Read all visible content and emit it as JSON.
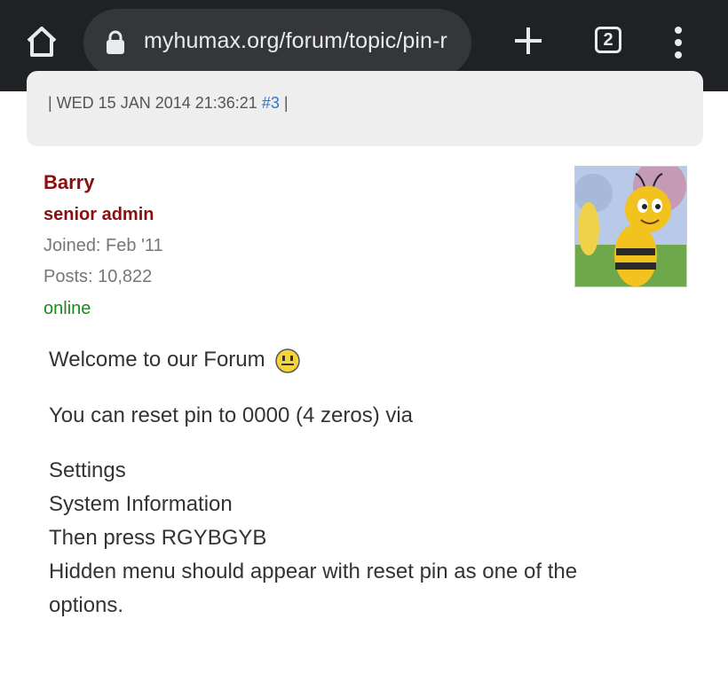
{
  "browser": {
    "url": "myhumax.org/forum/topic/pin-r",
    "tab_count": "2"
  },
  "post": {
    "meta_prefix": "| WED 15 JAN 2014 21:36:21",
    "post_number": "#3",
    "meta_suffix": "|",
    "author": {
      "name": "Barry",
      "role": "senior admin",
      "joined": "Joined: Feb '11",
      "posts": "Posts: 10,822",
      "status": "online"
    },
    "body": {
      "line1": "Welcome to our Forum",
      "line2": "You can reset pin to 0000 (4 zeros) via",
      "line3": "Settings",
      "line4": "System Information",
      "line5": "Then press RGYBGYB",
      "line6": "Hidden menu should appear with reset pin as one of the options."
    }
  },
  "colors": {
    "toolbar": "#202124",
    "author": "#8b0f0f",
    "online": "#1a8a1a",
    "link": "#2d78c8"
  }
}
